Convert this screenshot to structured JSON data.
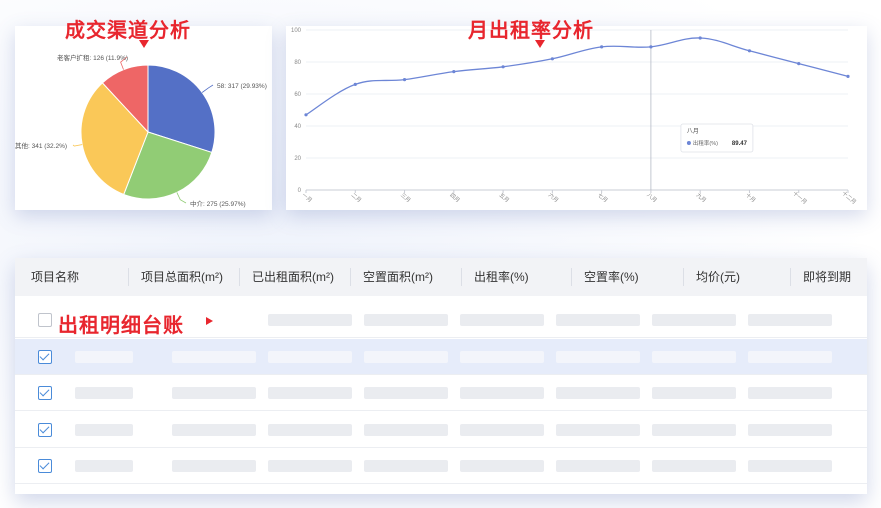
{
  "annotations": {
    "pie_title": "成交渠道分析",
    "line_title": "月出租率分析",
    "table_title": "出租明细台账"
  },
  "colors": {
    "accent": "#e8262e",
    "series_line": "#6d86d6",
    "pie": [
      "#5470c6",
      "#91cc75",
      "#fac858",
      "#ee6666"
    ]
  },
  "chart_data": [
    {
      "type": "pie",
      "slices": [
        {
          "label": "58: 317 (29.93%)",
          "name": "58",
          "value": 317,
          "percent": 29.93
        },
        {
          "label": "中介: 275 (25.97%)",
          "name": "中介",
          "value": 275,
          "percent": 25.97
        },
        {
          "label": "其他: 341 (32.2%)",
          "name": "其他",
          "value": 341,
          "percent": 32.2
        },
        {
          "label": "老客户扩租: 126 (11.9%)",
          "name": "老客户扩租",
          "value": 126,
          "percent": 11.9
        }
      ]
    },
    {
      "type": "line",
      "categories": [
        "一月",
        "二月",
        "三月",
        "四月",
        "五月",
        "六月",
        "七月",
        "八月",
        "九月",
        "十月",
        "十一月",
        "十二月"
      ],
      "series": [
        {
          "name": "出租率(%)",
          "values": [
            47,
            66,
            69,
            74,
            77,
            82,
            89.47,
            89.47,
            95,
            87,
            79,
            71
          ]
        }
      ],
      "ylim": [
        0,
        100
      ],
      "yticks": [
        "0",
        "20",
        "40",
        "60",
        "80",
        "100"
      ],
      "grid": true,
      "tooltip": {
        "title": "八月",
        "series_label": "出租率(%)",
        "value": "89.47"
      }
    }
  ],
  "table": {
    "columns": [
      "项目名称",
      "项目总面积(m²)",
      "已出租面积(m²)",
      "空置面积(m²)",
      "出租率(%)",
      "空置率(%)",
      "均价(元)",
      "即将到期"
    ],
    "rows": [
      {
        "checked": false,
        "selected": false
      },
      {
        "checked": true,
        "selected": true
      },
      {
        "checked": true,
        "selected": false
      },
      {
        "checked": true,
        "selected": false
      },
      {
        "checked": true,
        "selected": false
      }
    ]
  }
}
